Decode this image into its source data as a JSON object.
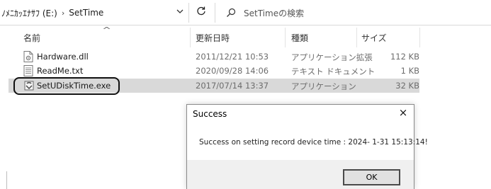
{
  "address_bar": {
    "drive": "ﾉﾒﾆｶｯｴﾅｻﾌ (E:)",
    "separator": "›",
    "folder": "SetTime",
    "dropdown_icon": "chevron-down-icon",
    "refresh_icon": "refresh-icon",
    "search_placeholder": "SetTimeの検索"
  },
  "columns": {
    "name": "名前",
    "date": "更新日時",
    "type": "種類",
    "size": "サイズ",
    "sort_indicator": "^"
  },
  "files": [
    {
      "name": "Hardware.dll",
      "date": "2011/12/21 10:53",
      "type": "アプリケーション拡張",
      "size": "112 KB",
      "icon": "dll-file-icon"
    },
    {
      "name": "ReadMe.txt",
      "date": "2020/09/28 14:06",
      "type": "テキスト ドキュメント",
      "size": "1 KB",
      "icon": "text-file-icon"
    },
    {
      "name": "SetUDiskTime.exe",
      "date": "2017/07/14 13:37",
      "type": "アプリケーション",
      "size": "32 KB",
      "icon": "exe-file-icon",
      "selected": true
    }
  ],
  "dialog": {
    "title": "Success",
    "close_label": "×",
    "message": "Success on setting record device time : 2024- 1-31 15:13:14!",
    "ok_label": "OK"
  },
  "colors": {
    "selection": "#d9d9d9",
    "dialog_footer": "#f0f0f0",
    "ok_border": "#4a4a4a"
  }
}
